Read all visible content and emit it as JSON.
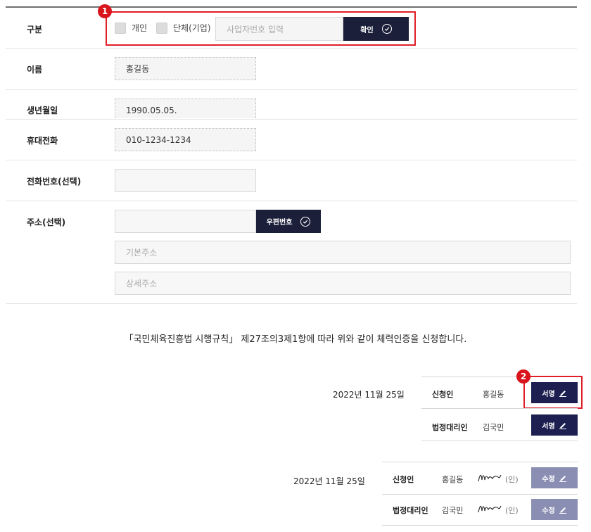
{
  "form": {
    "type": {
      "label": "구분",
      "option_individual": "개인",
      "option_group": "단체(기업)",
      "business_number_placeholder": "사업자번호 입력",
      "confirm_button": "확인"
    },
    "name": {
      "label": "이름",
      "value": "홍길동"
    },
    "birthdate": {
      "label": "생년월일",
      "value": "1990.05.05."
    },
    "mobile": {
      "label": "휴대전화",
      "value": "010-1234-1234"
    },
    "phone": {
      "label": "전화번호(선택)",
      "value": ""
    },
    "address": {
      "label": "주소(선택)",
      "zipcode_value": "",
      "zipcode_button": "우편번호",
      "basic_placeholder": "기본주소",
      "detail_placeholder": "상세주소"
    }
  },
  "statement": "「국민체육진흥법 시행규칙」 제27조의3제1항에 따라 위와 같이 체력인증을 신청합니다.",
  "sign_block_1": {
    "date": "2022년 11월 25일",
    "applicant_label": "신청인",
    "applicant_name": "홍길동",
    "applicant_button": "서명",
    "guardian_label": "법정대리인",
    "guardian_name": "김국민",
    "guardian_button": "서명"
  },
  "sign_block_2": {
    "date": "2022년 11월 25일",
    "applicant_label": "신청인",
    "applicant_name": "홍길동",
    "applicant_seal": "(인)",
    "applicant_button": "수정",
    "guardian_label": "법정대리인",
    "guardian_name": "김국민",
    "guardian_seal": "(인)",
    "guardian_button": "수정"
  },
  "markers": {
    "one": "1",
    "two": "2"
  },
  "colors": {
    "dark_button": "#1c1f3a",
    "sign_button": "#1c1f4f",
    "edit_button": "#8a8eb2",
    "highlight": "#e01f28"
  },
  "icons": {
    "confirm": "check-circle-icon",
    "sign": "pen-icon"
  }
}
